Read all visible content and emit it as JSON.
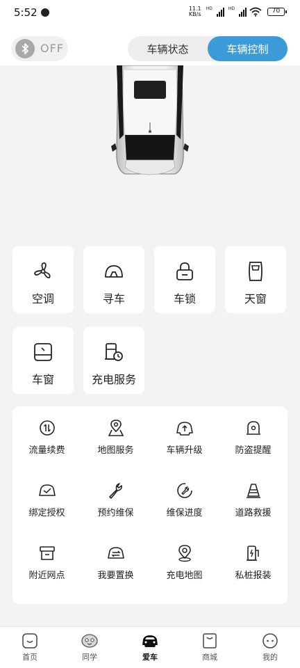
{
  "status_bar": {
    "time": "5:52",
    "speed_value": "11.1",
    "speed_unit": "KB/s",
    "hd_label": "HD",
    "battery": "70"
  },
  "header": {
    "bluetooth_state": "OFF",
    "tabs": [
      {
        "label": "车辆状态",
        "active": false
      },
      {
        "label": "车辆控制",
        "active": true
      }
    ]
  },
  "quick_controls": [
    {
      "label": "空调",
      "icon": "fan-icon"
    },
    {
      "label": "寻车",
      "icon": "find-car-icon"
    },
    {
      "label": "车锁",
      "icon": "lock-icon"
    },
    {
      "label": "天窗",
      "icon": "sunroof-icon"
    },
    {
      "label": "车窗",
      "icon": "car-window-icon"
    },
    {
      "label": "充电服务",
      "icon": "charging-station-icon"
    }
  ],
  "services": [
    {
      "label": "流量续费",
      "icon": "data-transfer-icon"
    },
    {
      "label": "地图服务",
      "icon": "map-pin-icon"
    },
    {
      "label": "车辆升级",
      "icon": "car-upgrade-icon"
    },
    {
      "label": "防盗提醒",
      "icon": "alarm-icon"
    },
    {
      "label": "绑定授权",
      "icon": "car-check-icon"
    },
    {
      "label": "预约维保",
      "icon": "wrench-icon"
    },
    {
      "label": "维保进度",
      "icon": "service-progress-icon"
    },
    {
      "label": "道路救援",
      "icon": "traffic-cone-icon"
    },
    {
      "label": "附近网点",
      "icon": "store-icon"
    },
    {
      "label": "我要置换",
      "icon": "car-swap-icon"
    },
    {
      "label": "充电地图",
      "icon": "location-icon"
    },
    {
      "label": "私桩报装",
      "icon": "fuel-pump-icon"
    }
  ],
  "tab_bar": [
    {
      "label": "首页",
      "icon": "home-icon",
      "active": false
    },
    {
      "label": "同学",
      "icon": "mascot-icon",
      "active": false
    },
    {
      "label": "爱车",
      "icon": "car-icon",
      "active": true
    },
    {
      "label": "商城",
      "icon": "shopping-bag-icon",
      "active": false
    },
    {
      "label": "我的",
      "icon": "profile-face-icon",
      "active": false
    }
  ],
  "colors": {
    "accent": "#3b9bd9",
    "page_background": "#f3f3f3",
    "card_background": "#ffffff"
  }
}
